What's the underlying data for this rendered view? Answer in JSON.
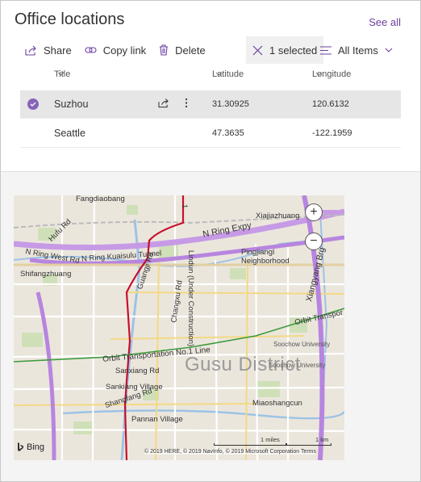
{
  "webpart": {
    "title": "Office locations",
    "see_all": "See all"
  },
  "commands": {
    "share": "Share",
    "copy_link": "Copy link",
    "delete": "Delete",
    "selected": "1 selected",
    "view": "All Items"
  },
  "columns": {
    "title": "Title",
    "latitude": "Latitude",
    "longitude": "Longitude"
  },
  "rows": [
    {
      "title": "Suzhou",
      "latitude": "31.30925",
      "longitude": "120.6132",
      "selected": true
    },
    {
      "title": "Seattle",
      "latitude": "47.3635",
      "longitude": "-122.1959",
      "selected": false
    }
  ],
  "map": {
    "labels": {
      "fangdiaobang": "Fangdiaobang",
      "xiajiazhuang": "Xiajiazhuang",
      "hufu_rd": "Hufu Rd",
      "n_ring_expy": "N Ring Expy",
      "n_ring_west_rd": "N Ring West Rd",
      "n_ring_kuaisulu_tunnel": "N Ring Kuaisulu Tunnel",
      "pingjiang": "Pingjiangl",
      "neighborhood": "Neighborhood",
      "shifangzhuang": "Shifangzhuang",
      "xiangyang_brg": "Xiangyang Brg",
      "lindun": "Lindun (Under Construction)",
      "guangji_rd": "Guangji Rd",
      "changxu_rd": "Changxu Rd",
      "orbit_transport_east": "Orbit Transpor",
      "soochow_university": "Soochow University",
      "orbit_transportation_line": "Orbit Transportation No.1 Line",
      "district": "Gusu District",
      "sanxiang_rd": "Sanxiang Rd",
      "sanxiang_village": "Sankiang Village",
      "shangfang_rd": "Shangfang Rd",
      "miaoshangcun": "Miaoshangcun",
      "pannan_village": "Pannan Village",
      "rennin_rd": "Rennin Rd",
      "soochow_east": "Soochow University",
      "number": "1"
    },
    "attribution": "© 2019 HERE, © 2019 NavInfo, © 2019 Microsoft Corporation Terms",
    "brand": "Bing",
    "scale_miles": "1 miles",
    "scale_km": "1 km",
    "zoom_in_glyph": "+",
    "zoom_out_glyph": "−"
  },
  "colors": {
    "accent": "#6b3fa0",
    "check": "#8764b8",
    "selected_row": "#e6e6e6",
    "metro_red": "#c8102e",
    "orbit_green": "#3d9a3d",
    "highway_purple": "#a573d8"
  }
}
